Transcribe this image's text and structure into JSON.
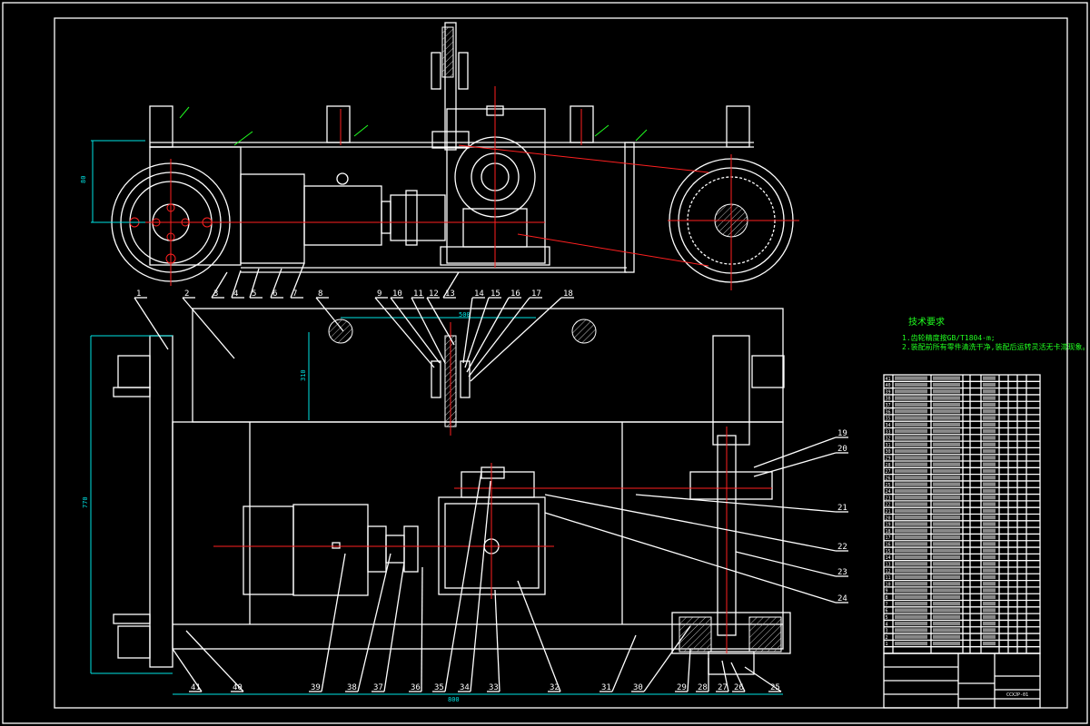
{
  "drawing": {
    "tech_requirements": {
      "heading": "技术要求",
      "lines": [
        "1.齿轮精度按GB/T1804-m;",
        "2.装配前所有零件清洗干净,装配后运转灵活无卡滞现象。"
      ]
    },
    "dimensions": [
      "80",
      "500",
      "310",
      "770",
      "800"
    ],
    "part_labels_top": [
      "1",
      "2",
      "3",
      "4",
      "5",
      "6",
      "7",
      "8",
      "9",
      "10",
      "11",
      "12",
      "13",
      "14",
      "15",
      "16",
      "17",
      "18"
    ],
    "part_labels_right": [
      "19",
      "20",
      "21",
      "22",
      "23",
      "24"
    ],
    "part_labels_bottom": [
      "25",
      "26",
      "27",
      "28",
      "29",
      "30",
      "31",
      "32",
      "33",
      "34",
      "35",
      "36",
      "37",
      "38",
      "39",
      "40",
      "41"
    ],
    "bom_row_count": 41,
    "title_block": {
      "drawing_no": "CCXJP-01"
    },
    "colors": {
      "outline": "#ffffff",
      "centerline": "#ff2020",
      "dimension": "#00e5e5",
      "annotation": "#20ff20",
      "background": "#000000"
    }
  }
}
